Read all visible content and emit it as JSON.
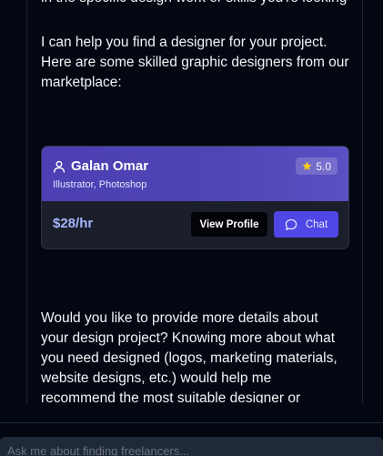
{
  "chat": {
    "previous_message_tail": "in the specific design work or skills you're looking for, so I can recommend the best match for your project needs.",
    "intro": "I can help you find a designer for your project. Here are some skilled graphic designers from our marketplace:",
    "followup": "Would you like to provide more details about your design project? Knowing more about what you need designed (logos, marketing materials, website designs, etc.) would help me recommend the most suitable designer or suggest additional candidates with specialized skills in those areas."
  },
  "designer_card": {
    "name": "Galan Omar",
    "skills": "Illustrator, Photoshop",
    "rating": "5.0",
    "price": "$28/hr",
    "view_profile_label": "View Profile",
    "chat_label": "Chat",
    "icons": {
      "user": "user-icon",
      "rating": "star-icon",
      "chat": "message-bubble-icon"
    }
  },
  "composer": {
    "placeholder": "Ask me about finding freelancers..."
  },
  "colors": {
    "background": "#030712",
    "card_header": "#4f46b5",
    "card_body": "#1a1f2b",
    "accent": "#4f46e5",
    "price": "#a5b4fc",
    "star": "#facc15"
  }
}
